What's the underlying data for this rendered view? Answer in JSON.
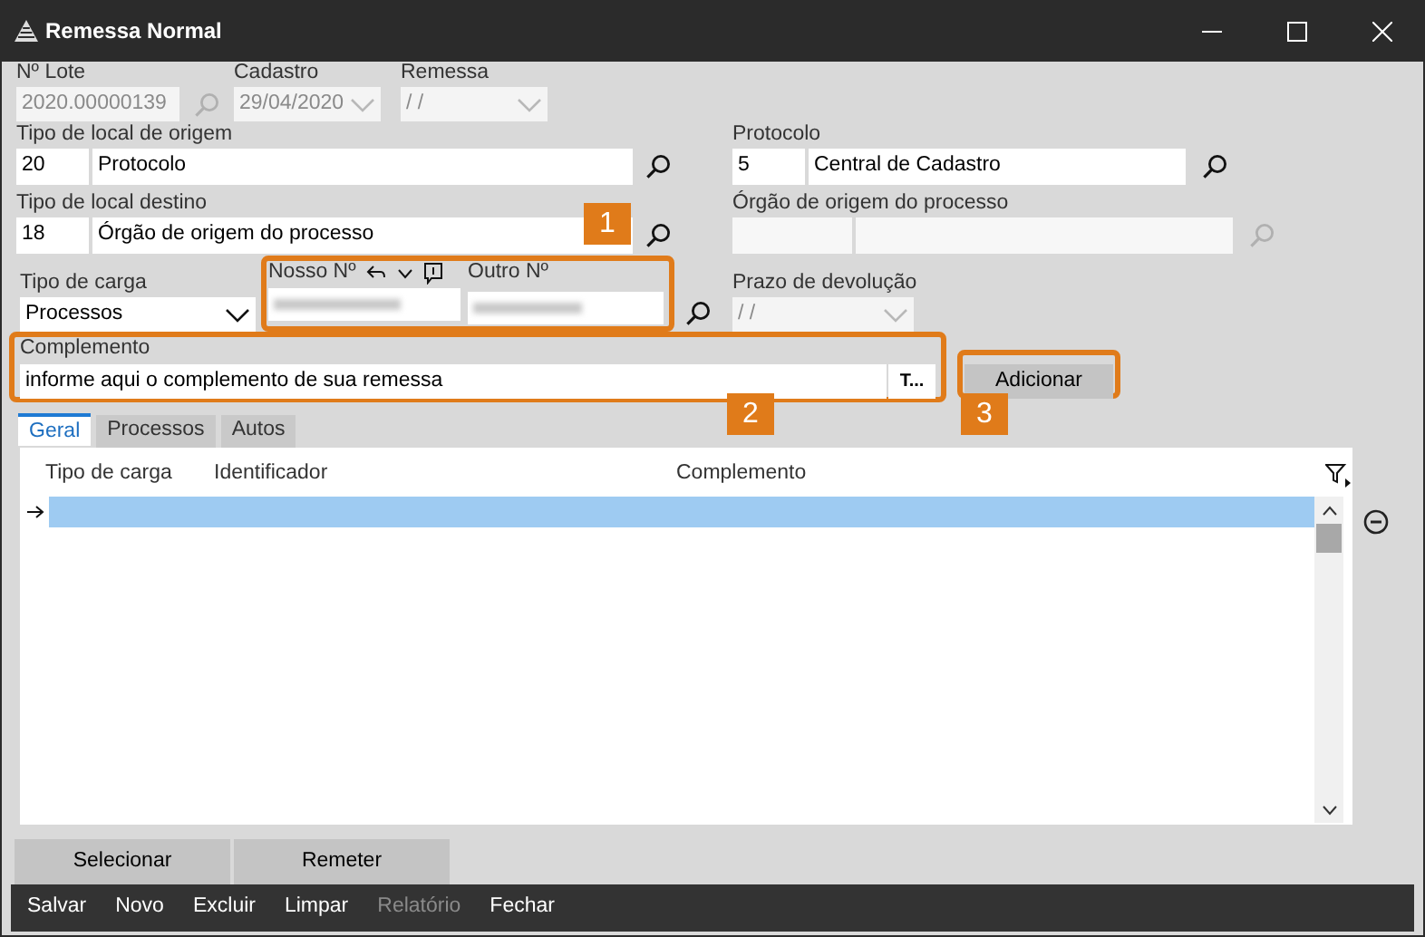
{
  "window": {
    "title": "Remessa Normal"
  },
  "top_fields": [
    {
      "kind": "search",
      "label": "Nº Lote",
      "value": "2020.00000139",
      "disabled": true
    },
    {
      "kind": "date",
      "label": "Cadastro",
      "value": "29/04/2020",
      "disabled": true
    },
    {
      "kind": "date",
      "label": "Remessa",
      "value": "/ /",
      "disabled": true
    }
  ],
  "origem": {
    "label": "Tipo de local de origem",
    "code": "20",
    "name": "Protocolo"
  },
  "protocolo": {
    "label": "Protocolo",
    "code": "5",
    "name": "Central de Cadastro"
  },
  "destino": {
    "label": "Tipo de local destino",
    "code": "18",
    "name": "Órgão de origem do processo"
  },
  "orgao_origem": {
    "label": "Órgão de origem do processo",
    "disabled": true
  },
  "tipo_carga": {
    "label": "Tipo de carga",
    "value": "Processos"
  },
  "numeros": {
    "nosso_label": "Nosso Nº",
    "outro_label": "Outro Nº"
  },
  "prazo": {
    "label": "Prazo de devolução",
    "value": "/ /",
    "disabled": true
  },
  "complemento": {
    "label": "Complemento",
    "value": "informe aqui o complemento de sua remessa",
    "button": "T..."
  },
  "add_button": "Adicionar",
  "callouts": [
    "1",
    "2",
    "3"
  ],
  "tabs": [
    {
      "label": "Geral",
      "selected": true
    },
    {
      "label": "Processos",
      "selected": false
    },
    {
      "label": "Autos",
      "selected": false
    }
  ],
  "table": {
    "columns": [
      "Tipo de carga",
      "Identificador",
      "Complemento"
    ],
    "rows": [
      {
        "selected": true
      }
    ]
  },
  "action_buttons": [
    "Selecionar",
    "Remeter"
  ],
  "toolbar": [
    {
      "label": "Salvar",
      "disabled": false
    },
    {
      "label": "Novo",
      "disabled": false
    },
    {
      "label": "Excluir",
      "disabled": false
    },
    {
      "label": "Limpar",
      "disabled": false
    },
    {
      "label": "Relatório",
      "disabled": true
    },
    {
      "label": "Fechar",
      "disabled": false
    }
  ]
}
